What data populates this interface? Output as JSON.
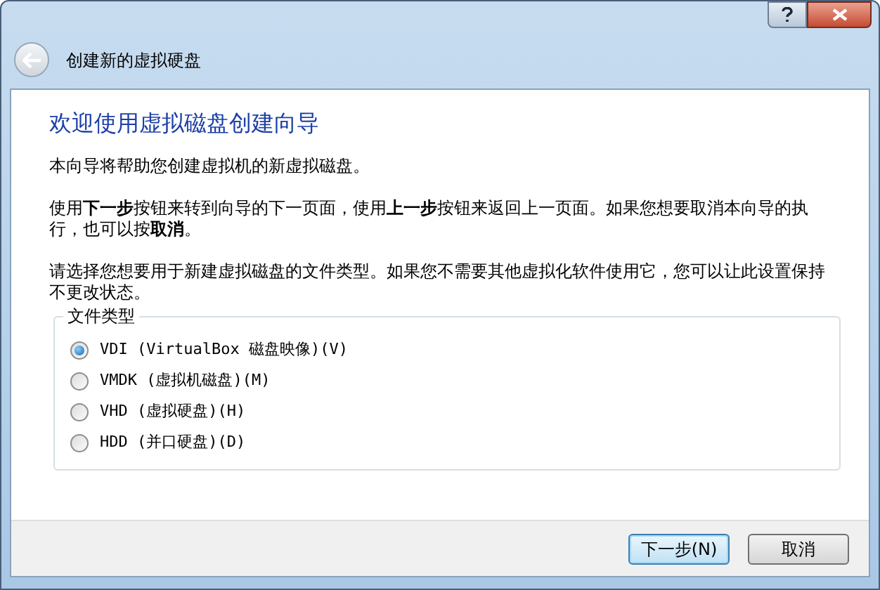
{
  "window": {
    "title": "创建新的虚拟硬盘"
  },
  "page": {
    "heading": "欢迎使用虚拟磁盘创建向导",
    "paragraphs": [
      "本向导将帮助您创建虚拟机的新虚拟磁盘。",
      "使用**下一步**按钮来转到向导的下一页面，使用**上一步**按钮来返回上一页面。如果您想要取消本向导的执行，也可以按**取消**。",
      "请选择您想要用于新建虚拟磁盘的文件类型。如果您不需要其他虚拟化软件使用它，您可以让此设置保持不更改状态。"
    ]
  },
  "file_type": {
    "legend": "文件类型",
    "options": [
      {
        "label": "VDI (VirtualBox 磁盘映像)(V)",
        "selected": true
      },
      {
        "label": "VMDK (虚拟机磁盘)(M)",
        "selected": false
      },
      {
        "label": "VHD (虚拟硬盘)(H)",
        "selected": false
      },
      {
        "label": "HDD (并口硬盘)(D)",
        "selected": false
      }
    ]
  },
  "buttons": [
    {
      "label": "下一步(N)",
      "focused": true
    },
    {
      "label": "取消",
      "focused": false
    }
  ]
}
